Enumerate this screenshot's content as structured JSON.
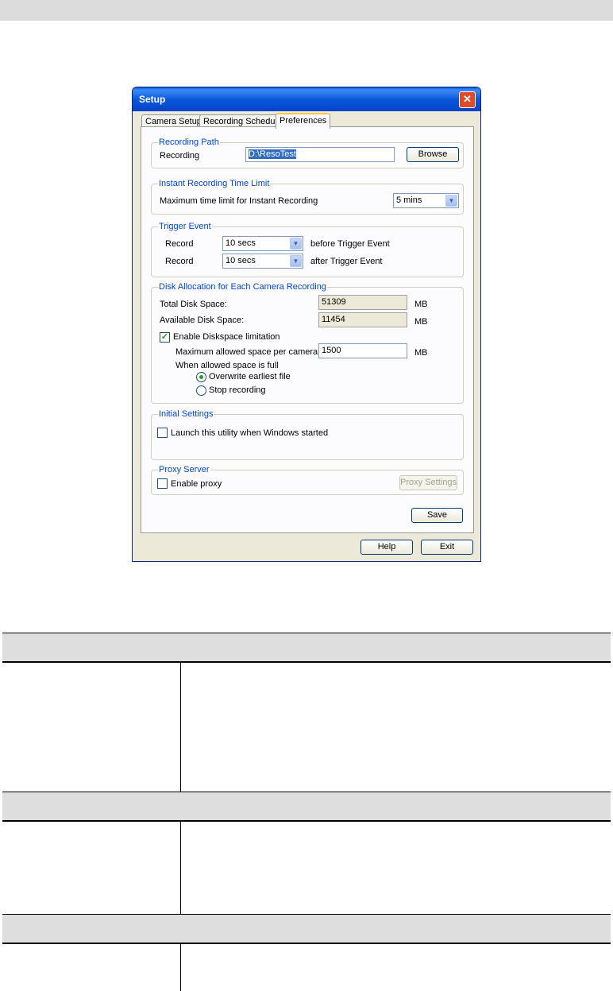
{
  "dialog": {
    "title": "Setup",
    "close_label": "✕",
    "tabs": [
      {
        "label": "Camera Setup",
        "active": false
      },
      {
        "label": "Recording Schedule",
        "active": false
      },
      {
        "label": "Preferences",
        "active": true
      }
    ],
    "recording_path": {
      "legend": "Recording Path",
      "label": "Recording",
      "value": "D:\\ResoTest",
      "browse_label": "Browse"
    },
    "instant_limit": {
      "legend": "Instant Recording Time Limit",
      "label": "Maximum time limit for Instant Recording",
      "value": "5 mins"
    },
    "trigger_event": {
      "legend": "Trigger Event",
      "before": {
        "label": "Record",
        "value": "10 secs",
        "suffix": "before Trigger Event"
      },
      "after": {
        "label": "Record",
        "value": "10 secs",
        "suffix": "after Trigger Event"
      }
    },
    "disk_allocation": {
      "legend": "Disk Allocation for Each Camera Recording",
      "total_label": "Total Disk Space:",
      "total_value": "51309",
      "available_label": "Available Disk Space:",
      "available_value": "11454",
      "unit": "MB",
      "enable_label": "Enable Diskspace limitation",
      "enable_checked": true,
      "max_label": "Maximum allowed space per camera:",
      "max_value": "1500",
      "full_label": "When allowed space is full",
      "overwrite_label": "Overwrite earliest file",
      "stop_label": "Stop recording",
      "selected": "overwrite"
    },
    "initial_settings": {
      "legend": "Initial Settings",
      "launch_label": "Launch this utility when Windows started",
      "launch_checked": false
    },
    "proxy": {
      "legend": "Proxy Server",
      "enable_label": "Enable proxy",
      "enable_checked": false,
      "settings_label": "Proxy Settings"
    },
    "save_label": "Save",
    "help_label": "Help",
    "exit_label": "Exit",
    "check_mark": "✓",
    "dropdown_arrow": "▼"
  }
}
